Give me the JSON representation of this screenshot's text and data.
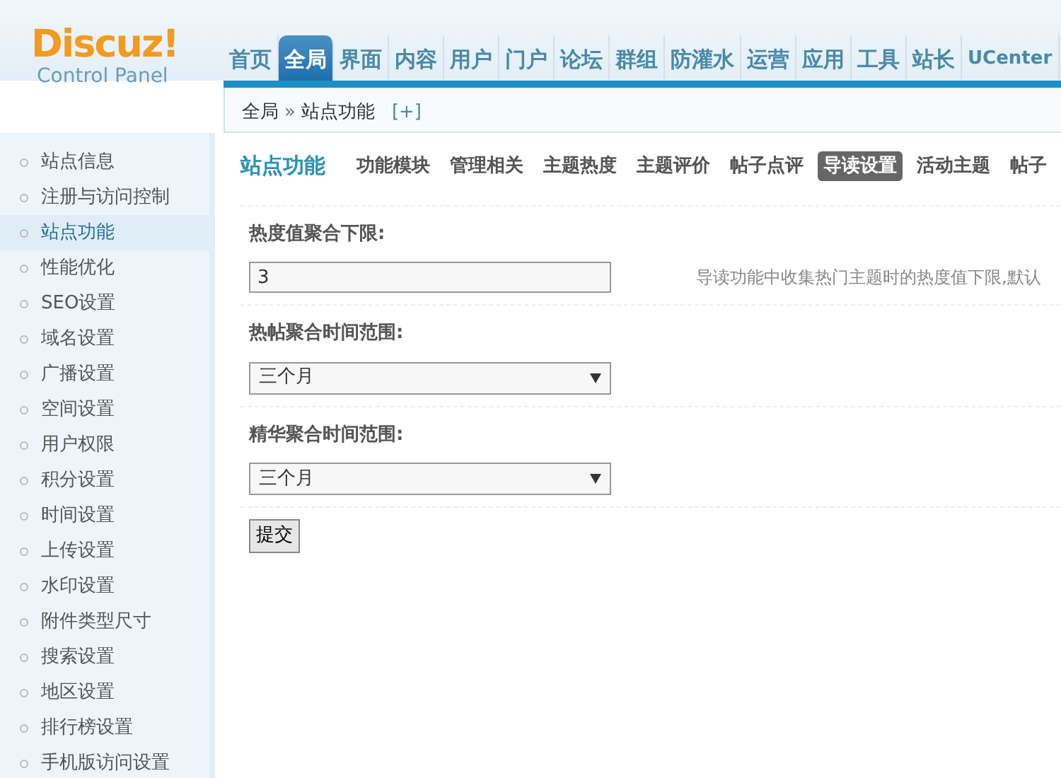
{
  "logo": {
    "title": "Discuz!",
    "subtitle": "Control Panel"
  },
  "top_nav": [
    {
      "label": "首页",
      "selected": false
    },
    {
      "label": "全局",
      "selected": true
    },
    {
      "label": "界面",
      "selected": false
    },
    {
      "label": "内容",
      "selected": false
    },
    {
      "label": "用户",
      "selected": false
    },
    {
      "label": "门户",
      "selected": false
    },
    {
      "label": "论坛",
      "selected": false
    },
    {
      "label": "群组",
      "selected": false
    },
    {
      "label": "防灌水",
      "selected": false
    },
    {
      "label": "运营",
      "selected": false
    },
    {
      "label": "应用",
      "selected": false
    },
    {
      "label": "工具",
      "selected": false
    },
    {
      "label": "站长",
      "selected": false
    },
    {
      "label": "UCenter",
      "selected": false
    }
  ],
  "breadcrumb": {
    "items": [
      "全局",
      "站点功能"
    ],
    "separator": "»",
    "add": "[+]"
  },
  "sidebar": {
    "items": [
      {
        "label": "站点信息",
        "selected": false
      },
      {
        "label": "注册与访问控制",
        "selected": false
      },
      {
        "label": "站点功能",
        "selected": true
      },
      {
        "label": "性能优化",
        "selected": false
      },
      {
        "label": "SEO设置",
        "selected": false
      },
      {
        "label": "域名设置",
        "selected": false
      },
      {
        "label": "广播设置",
        "selected": false
      },
      {
        "label": "空间设置",
        "selected": false
      },
      {
        "label": "用户权限",
        "selected": false
      },
      {
        "label": "积分设置",
        "selected": false
      },
      {
        "label": "时间设置",
        "selected": false
      },
      {
        "label": "上传设置",
        "selected": false
      },
      {
        "label": "水印设置",
        "selected": false
      },
      {
        "label": "附件类型尺寸",
        "selected": false
      },
      {
        "label": "搜索设置",
        "selected": false
      },
      {
        "label": "地区设置",
        "selected": false
      },
      {
        "label": "排行榜设置",
        "selected": false
      },
      {
        "label": "手机版访问设置",
        "selected": false
      }
    ]
  },
  "content": {
    "title": "站点功能",
    "tabs": [
      {
        "label": "功能模块",
        "selected": false
      },
      {
        "label": "管理相关",
        "selected": false
      },
      {
        "label": "主题热度",
        "selected": false
      },
      {
        "label": "主题评价",
        "selected": false
      },
      {
        "label": "帖子点评",
        "selected": false
      },
      {
        "label": "导读设置",
        "selected": true
      },
      {
        "label": "活动主题",
        "selected": false
      },
      {
        "label": "帖子",
        "selected": false
      }
    ],
    "fields": [
      {
        "kind": "text",
        "label": "热度值聚合下限:",
        "value": "3",
        "hint": "导读功能中收集热门主题时的热度值下限,默认"
      },
      {
        "kind": "select",
        "label": "热帖聚合时间范围:",
        "value": "三个月"
      },
      {
        "kind": "select",
        "label": "精华聚合时间范围:",
        "value": "三个月"
      }
    ],
    "submit": "提交"
  }
}
